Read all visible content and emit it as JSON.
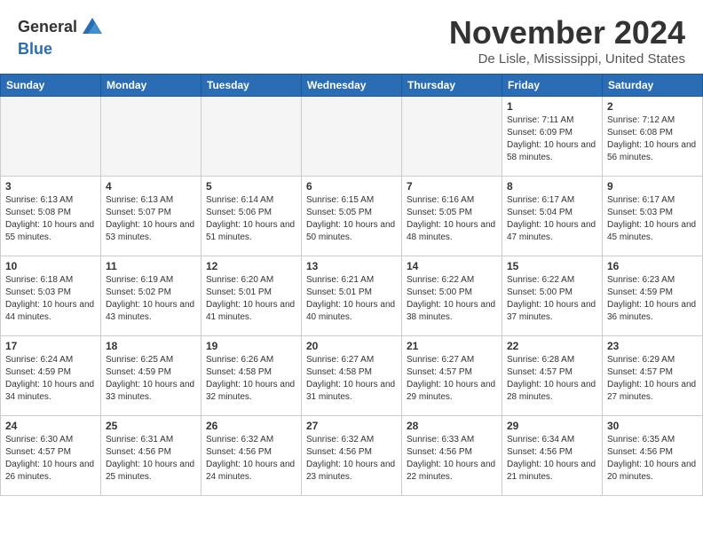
{
  "header": {
    "logo_line1": "General",
    "logo_line2": "Blue",
    "month_year": "November 2024",
    "location": "De Lisle, Mississippi, United States"
  },
  "days_of_week": [
    "Sunday",
    "Monday",
    "Tuesday",
    "Wednesday",
    "Thursday",
    "Friday",
    "Saturday"
  ],
  "weeks": [
    [
      {
        "day": "",
        "info": ""
      },
      {
        "day": "",
        "info": ""
      },
      {
        "day": "",
        "info": ""
      },
      {
        "day": "",
        "info": ""
      },
      {
        "day": "",
        "info": ""
      },
      {
        "day": "1",
        "info": "Sunrise: 7:11 AM\nSunset: 6:09 PM\nDaylight: 10 hours\nand 58 minutes."
      },
      {
        "day": "2",
        "info": "Sunrise: 7:12 AM\nSunset: 6:08 PM\nDaylight: 10 hours\nand 56 minutes."
      }
    ],
    [
      {
        "day": "3",
        "info": "Sunrise: 6:13 AM\nSunset: 5:08 PM\nDaylight: 10 hours\nand 55 minutes."
      },
      {
        "day": "4",
        "info": "Sunrise: 6:13 AM\nSunset: 5:07 PM\nDaylight: 10 hours\nand 53 minutes."
      },
      {
        "day": "5",
        "info": "Sunrise: 6:14 AM\nSunset: 5:06 PM\nDaylight: 10 hours\nand 51 minutes."
      },
      {
        "day": "6",
        "info": "Sunrise: 6:15 AM\nSunset: 5:05 PM\nDaylight: 10 hours\nand 50 minutes."
      },
      {
        "day": "7",
        "info": "Sunrise: 6:16 AM\nSunset: 5:05 PM\nDaylight: 10 hours\nand 48 minutes."
      },
      {
        "day": "8",
        "info": "Sunrise: 6:17 AM\nSunset: 5:04 PM\nDaylight: 10 hours\nand 47 minutes."
      },
      {
        "day": "9",
        "info": "Sunrise: 6:17 AM\nSunset: 5:03 PM\nDaylight: 10 hours\nand 45 minutes."
      }
    ],
    [
      {
        "day": "10",
        "info": "Sunrise: 6:18 AM\nSunset: 5:03 PM\nDaylight: 10 hours\nand 44 minutes."
      },
      {
        "day": "11",
        "info": "Sunrise: 6:19 AM\nSunset: 5:02 PM\nDaylight: 10 hours\nand 43 minutes."
      },
      {
        "day": "12",
        "info": "Sunrise: 6:20 AM\nSunset: 5:01 PM\nDaylight: 10 hours\nand 41 minutes."
      },
      {
        "day": "13",
        "info": "Sunrise: 6:21 AM\nSunset: 5:01 PM\nDaylight: 10 hours\nand 40 minutes."
      },
      {
        "day": "14",
        "info": "Sunrise: 6:22 AM\nSunset: 5:00 PM\nDaylight: 10 hours\nand 38 minutes."
      },
      {
        "day": "15",
        "info": "Sunrise: 6:22 AM\nSunset: 5:00 PM\nDaylight: 10 hours\nand 37 minutes."
      },
      {
        "day": "16",
        "info": "Sunrise: 6:23 AM\nSunset: 4:59 PM\nDaylight: 10 hours\nand 36 minutes."
      }
    ],
    [
      {
        "day": "17",
        "info": "Sunrise: 6:24 AM\nSunset: 4:59 PM\nDaylight: 10 hours\nand 34 minutes."
      },
      {
        "day": "18",
        "info": "Sunrise: 6:25 AM\nSunset: 4:59 PM\nDaylight: 10 hours\nand 33 minutes."
      },
      {
        "day": "19",
        "info": "Sunrise: 6:26 AM\nSunset: 4:58 PM\nDaylight: 10 hours\nand 32 minutes."
      },
      {
        "day": "20",
        "info": "Sunrise: 6:27 AM\nSunset: 4:58 PM\nDaylight: 10 hours\nand 31 minutes."
      },
      {
        "day": "21",
        "info": "Sunrise: 6:27 AM\nSunset: 4:57 PM\nDaylight: 10 hours\nand 29 minutes."
      },
      {
        "day": "22",
        "info": "Sunrise: 6:28 AM\nSunset: 4:57 PM\nDaylight: 10 hours\nand 28 minutes."
      },
      {
        "day": "23",
        "info": "Sunrise: 6:29 AM\nSunset: 4:57 PM\nDaylight: 10 hours\nand 27 minutes."
      }
    ],
    [
      {
        "day": "24",
        "info": "Sunrise: 6:30 AM\nSunset: 4:57 PM\nDaylight: 10 hours\nand 26 minutes."
      },
      {
        "day": "25",
        "info": "Sunrise: 6:31 AM\nSunset: 4:56 PM\nDaylight: 10 hours\nand 25 minutes."
      },
      {
        "day": "26",
        "info": "Sunrise: 6:32 AM\nSunset: 4:56 PM\nDaylight: 10 hours\nand 24 minutes."
      },
      {
        "day": "27",
        "info": "Sunrise: 6:32 AM\nSunset: 4:56 PM\nDaylight: 10 hours\nand 23 minutes."
      },
      {
        "day": "28",
        "info": "Sunrise: 6:33 AM\nSunset: 4:56 PM\nDaylight: 10 hours\nand 22 minutes."
      },
      {
        "day": "29",
        "info": "Sunrise: 6:34 AM\nSunset: 4:56 PM\nDaylight: 10 hours\nand 21 minutes."
      },
      {
        "day": "30",
        "info": "Sunrise: 6:35 AM\nSunset: 4:56 PM\nDaylight: 10 hours\nand 20 minutes."
      }
    ]
  ]
}
